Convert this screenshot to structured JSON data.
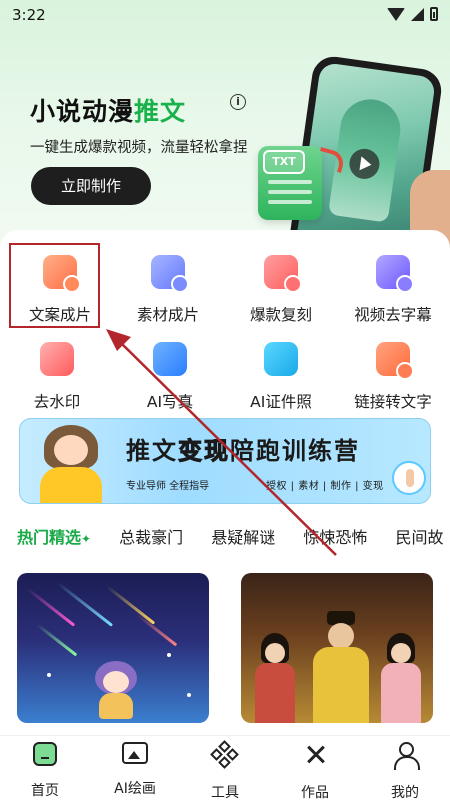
{
  "status_bar": {
    "time": "3:22"
  },
  "hero": {
    "title_part1": "小说动漫",
    "title_highlight": "推文",
    "subtitle": "一键生成爆款视频，流量轻松拿捏",
    "cta_label": "立即制作",
    "tag_text": "TXT",
    "accent_color": "#19b24a"
  },
  "tools": [
    {
      "label": "文案成片",
      "icon": "text-to-video-icon"
    },
    {
      "label": "素材成片",
      "icon": "media-to-video-icon"
    },
    {
      "label": "爆款复刻",
      "icon": "replicate-icon"
    },
    {
      "label": "视频去字幕",
      "icon": "remove-subtitle-icon"
    },
    {
      "label": "去水印",
      "icon": "watermark-remove-icon"
    },
    {
      "label": "AI写真",
      "icon": "camera-icon"
    },
    {
      "label": "AI证件照",
      "icon": "id-photo-icon"
    },
    {
      "label": "链接转文字",
      "icon": "link-to-text-icon"
    }
  ],
  "banner": {
    "title_a": "推文",
    "title_b": "变现",
    "title_c": "陪跑训练营",
    "sub_left": "专业导师 全程指导",
    "sub_right": "授权 | 素材 | 制作 | 变现"
  },
  "tabs": [
    "热门精选",
    "总裁豪门",
    "悬疑解谜",
    "惊悚恐怖",
    "民间故"
  ],
  "bottom_nav": [
    {
      "label": "首页",
      "icon": "home-icon"
    },
    {
      "label": "AI绘画",
      "icon": "image-icon"
    },
    {
      "label": "工具",
      "icon": "tools-icon"
    },
    {
      "label": "作品",
      "icon": "works-icon"
    },
    {
      "label": "我的",
      "icon": "profile-icon"
    }
  ],
  "annotation_color": "#b3262c"
}
